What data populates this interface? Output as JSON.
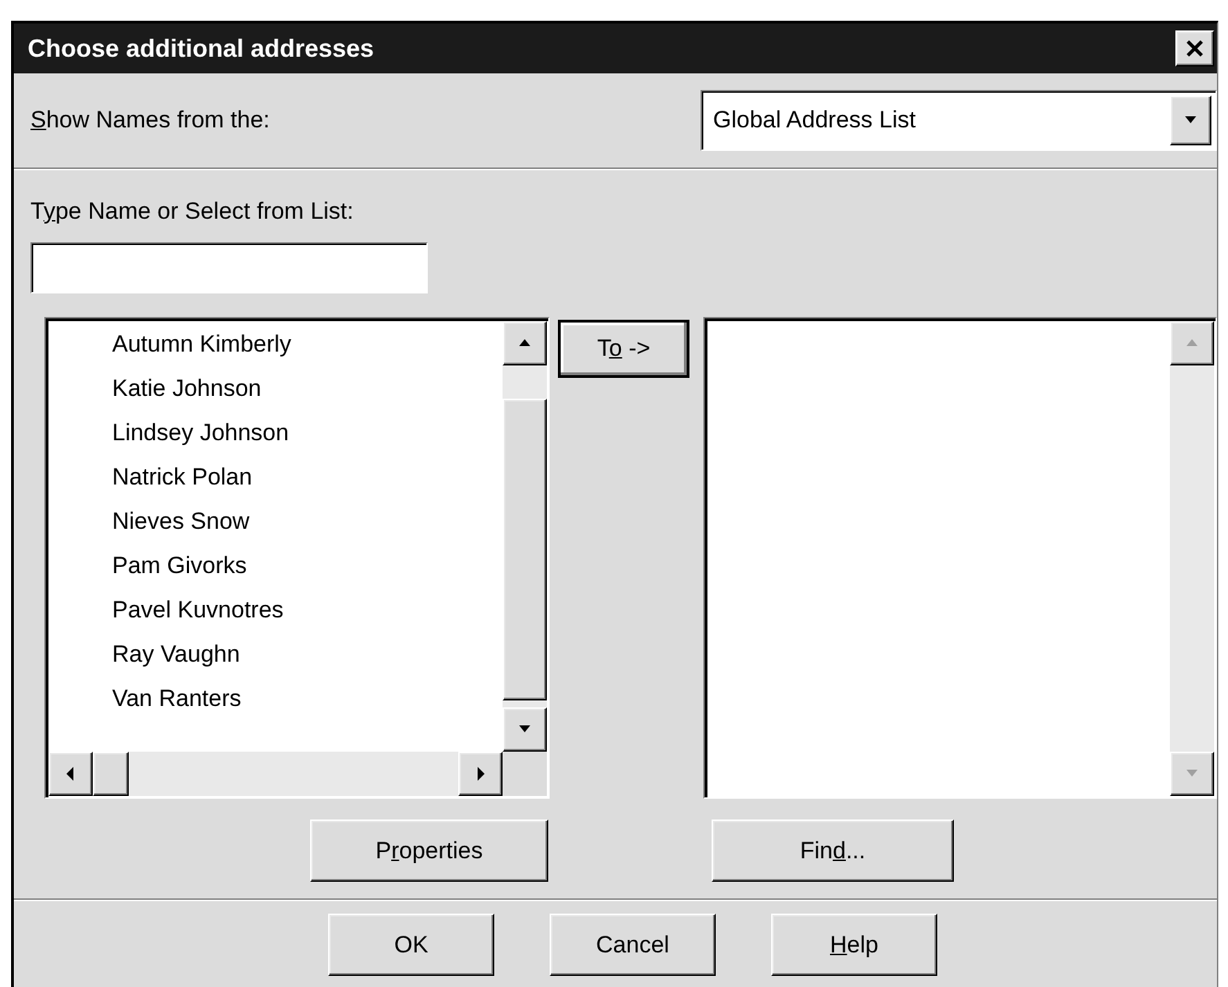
{
  "window": {
    "title": "Choose additional addresses"
  },
  "show_names": {
    "label": {
      "key": "S",
      "after": "how Names from the:"
    },
    "value": "Global Address List"
  },
  "type_name": {
    "label": {
      "before": "T",
      "key": "y",
      "after": "pe Name or Select from List:"
    }
  },
  "names_list": {
    "items": [
      {
        "name": "Autumn Kimberly",
        "selected": false
      },
      {
        "name": "Katie Johnson",
        "selected": false
      },
      {
        "name": "Lindsey Johnson",
        "selected": false
      },
      {
        "name": "Natrick Polan",
        "selected": false
      },
      {
        "name": "Nieves Snow",
        "selected": false
      },
      {
        "name": "Pam Givorks",
        "selected": false
      },
      {
        "name": "Pavel Kuvnotres",
        "selected": false
      },
      {
        "name": "Ray Vaughn",
        "selected": false
      },
      {
        "name": "Van Ranters",
        "selected": false
      }
    ]
  },
  "to_button": {
    "label": {
      "before": "T",
      "key": "o",
      "after": " ->"
    },
    "default": true
  },
  "list_buttons": [
    {
      "label": {
        "before": "P",
        "key": "r",
        "after": "operties"
      }
    },
    {
      "label": {
        "before": "Fin",
        "key": "d",
        "after": "..."
      }
    }
  ],
  "footer_buttons": [
    {
      "label": {
        "before": "OK"
      }
    },
    {
      "label": {
        "before": "Cancel"
      }
    },
    {
      "label": {
        "key": "H",
        "after": "elp"
      }
    }
  ]
}
